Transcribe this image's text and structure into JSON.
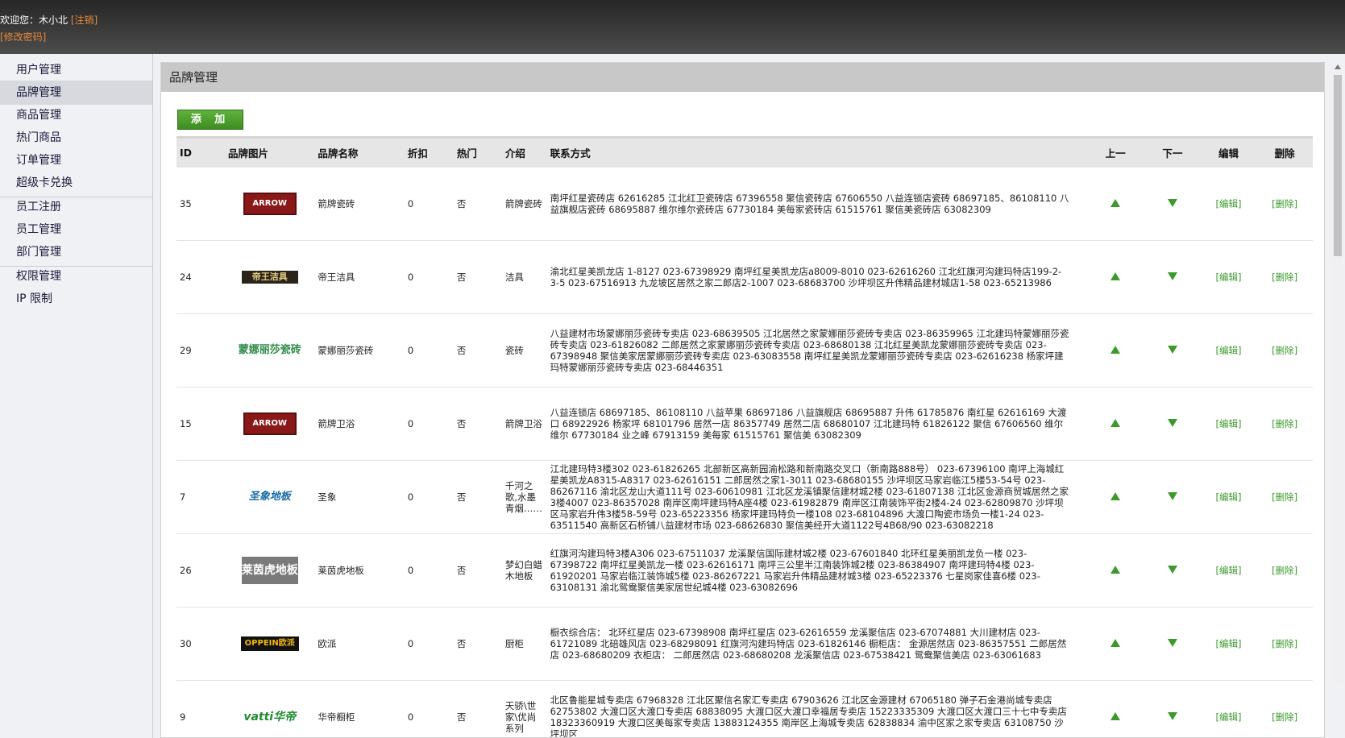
{
  "header": {
    "welcome_prefix": "欢迎您：",
    "username": "木小北",
    "logout": "[注销]",
    "change_password": "[修改密码]"
  },
  "sidebar": {
    "items": [
      {
        "label": "用户管理"
      },
      {
        "label": "品牌管理"
      },
      {
        "label": "商品管理"
      },
      {
        "label": "热门商品"
      },
      {
        "label": "订单管理"
      },
      {
        "label": "超级卡兑换"
      },
      {
        "label": "员工注册"
      },
      {
        "label": "员工管理"
      },
      {
        "label": "部门管理"
      },
      {
        "label": "权限管理"
      },
      {
        "label": "IP 限制"
      }
    ],
    "active": "品牌管理"
  },
  "panel": {
    "title": "品牌管理",
    "add_label": "添 加"
  },
  "table": {
    "headers": {
      "id": "ID",
      "image": "品牌图片",
      "name": "品牌名称",
      "discount": "折扣",
      "hot": "热门",
      "intro": "介绍",
      "contact": "联系方式",
      "up": "上一",
      "down": "下一",
      "edit": "编辑",
      "delete": "删除"
    },
    "edit_label": "[编辑]",
    "delete_label": "[删除]",
    "rows": [
      {
        "id": "35",
        "logo": "ARROW",
        "name": "箭牌瓷砖",
        "discount": "0",
        "hot": "否",
        "intro": "箭牌瓷砖",
        "contact": "南坪红星瓷砖店 62616285 江北红卫瓷砖店 67396558 聚信瓷砖店 67606550 八益连锁店瓷砖 68697185、86108110 八益旗舰店瓷砖 68695887 维尔维尔瓷砖店 67730184 美每家瓷砖店 61515761 聚信美瓷砖店 63082309"
      },
      {
        "id": "24",
        "logo": "帝王洁具",
        "name": "帝王洁具",
        "discount": "0",
        "hot": "否",
        "intro": "洁具",
        "contact": "渝北红星美凯龙店 1-8127 023-67398929 南坪红星美凯龙店a8009-8010 023-62616260 江北红旗河沟建玛特店199-2-3-5 023-67516913 九龙坡区居然之家二郎店2-1007 023-68683700 沙坪坝区升伟精品建材城店1-58 023-65213986"
      },
      {
        "id": "29",
        "logo": "蒙娜丽莎瓷砖",
        "name": "蒙娜丽莎瓷砖",
        "discount": "0",
        "hot": "否",
        "intro": "瓷砖",
        "contact": "八益建材市场蒙娜丽莎瓷砖专卖店 023-68639505 江北居然之家蒙娜丽莎瓷砖专卖店 023-86359965 江北建玛特蒙娜丽莎瓷砖专卖店 023-61826082 二郎居然之家蒙娜丽莎瓷砖专卖店 023-68680138 江北红星美凯龙蒙娜丽莎瓷砖专卖店 023-67398948 聚信美家居蒙娜丽莎瓷砖专卖店 023-63083558 南坪红星美凯龙蒙娜丽莎瓷砖专卖店 023-62616238 杨家坪建玛特蒙娜丽莎瓷砖专卖店 023-68446351"
      },
      {
        "id": "15",
        "logo": "ARROW",
        "name": "箭牌卫浴",
        "discount": "0",
        "hot": "否",
        "intro": "箭牌卫浴",
        "contact": "八益连锁店 68697185、86108110 八益苹果 68697186 八益旗舰店 68695887 升伟 61785876 南红星 62616169 大渡口 68922926 杨家坪 68101796 居然一店 86357749 居然二店 68680107 江北建玛特 61826122 聚信 67606560 维尔维尔 67730184 业之峰 67913159 美每家 61515761 聚信美 63082309"
      },
      {
        "id": "7",
        "logo": "圣象地板",
        "name": "圣象",
        "discount": "0",
        "hot": "否",
        "intro": "千河之歌,水墨青烟……",
        "contact": "江北建玛特3楼302 023-61826265 北部新区高新园渝松路和新南路交叉口（新南路888号） 023-67396100 南坪上海城红星美凯龙A8315-A8317 023-62616151 二郎居然之家1-3011 023-68680155 沙坪坝区马家岩临江5楼53-54号 023-86267116 渝北区龙山大道111号 023-60610981 江北区龙溪镇聚信建材城2楼 023-61807138 江北区金源商贸城居然之家3楼4007 023-86357028 南岸区南坪建玛特A座4楼 023-61982879 南岸区江南装饰平街2楼4-24 023-62809870 沙坪坝区马家岩升伟3楼58-59号 023-65223356 杨家坪建玛特负一楼108 023-68104896 大渡口陶瓷市场负一楼1-24 023-63511540 高新区石桥铺八益建材市场 023-68626830 聚信美经开大道1122号4B68/90 023-63082218"
      },
      {
        "id": "26",
        "logo": "莱茵虎地板",
        "name": "莱茵虎地板",
        "discount": "0",
        "hot": "否",
        "intro": "梦幻白蜡木地板",
        "contact": "红旗河沟建玛特3楼A306 023-67511037 龙溪聚信国际建材城2楼 023-67601840 北环红星美丽凯龙负一楼 023-67398722 南坪红星美凯龙一楼 023-62616171 南坪三公里半江南装饰城2楼 023-86384907 南坪建玛特4楼 023-61920201 马家岩临江装饰城5楼 023-86267221 马家岩升伟精品建材城3楼 023-65223376 七星岗家佳喜6楼 023-63108131 渝北鸳鸯聚信美家居世纪城4楼 023-63082696"
      },
      {
        "id": "30",
        "logo": "OPPEIN欧派",
        "name": "欧派",
        "discount": "0",
        "hot": "否",
        "intro": "厨柜",
        "contact": "橱衣综合店： 北环红星店 023-67398908 南坪红星店 023-62616559 龙溪聚信店 023-67074881 大川建材店 023-61721089 北碚雄风店 023-68298091 红旗河沟建玛特店 023-61826146 橱柜店： 金源居然店 023-86357551 二郎居然店 023-68680209 衣柜店： 二郎居然店 023-68680208 龙溪聚信店 023-67538421 鸳鸯聚信美店 023-63061683"
      },
      {
        "id": "9",
        "logo": "vatti华帝",
        "name": "华帝橱柜",
        "discount": "0",
        "hot": "否",
        "intro": "天骄\\世家\\优尚系列",
        "contact": "北区鲁能星城专卖店 67968328 江北区聚信名家汇专卖店 67903626 江北区金源建材 67065180 弹子石金港尚城专卖店 62753802 大渡口区大渡口专卖店 68838095 大渡口区大渡口幸福居专卖店 15223335309 大渡口区大渡口三十七中专卖店 18323360919 大渡口区美每家专卖店 13883124355 南岸区上海城专卖店 62838834 渝中区家之家专卖店 63108750 沙坪坝区"
      }
    ]
  }
}
